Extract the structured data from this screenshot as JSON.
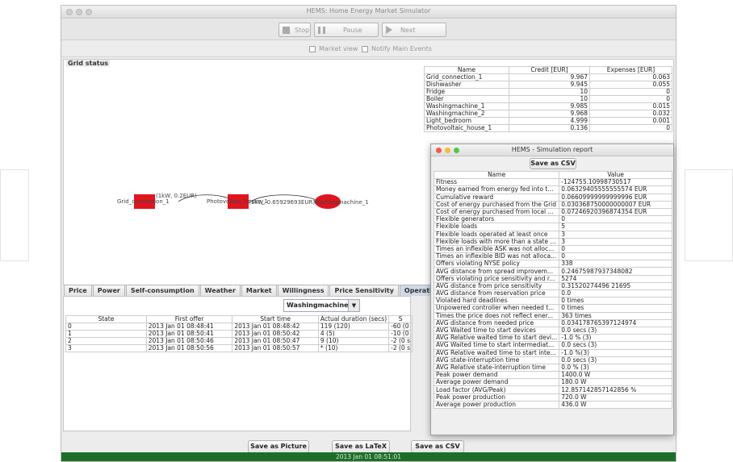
{
  "window": {
    "title": "HEMS: Home Energy Market Simulator"
  },
  "toolbar": {
    "stop_label": "Stop",
    "pause_label": "Pause",
    "next_label": "Next"
  },
  "options": {
    "market_view_label": "Market view",
    "notify_label": "Notify Main Events"
  },
  "grid_status": {
    "label": "Grid status",
    "credit_table": {
      "headers": [
        "Name",
        "Credit [EUR]",
        "Expenses [EUR]"
      ],
      "rows": [
        [
          "Grid_connection_1",
          "9.967",
          "0.063"
        ],
        [
          "Dishwasher",
          "9.945",
          "0.055"
        ],
        [
          "Fridge",
          "10",
          "0"
        ],
        [
          "Boiler",
          "10",
          "0"
        ],
        [
          "Washingmachine_1",
          "9.985",
          "0.015"
        ],
        [
          "Washingmachine_2",
          "9.968",
          "0.032"
        ],
        [
          "Light_bedroom",
          "4.999",
          "0.001"
        ],
        [
          "Photovoltaic_house_1",
          "0.136",
          "0"
        ]
      ]
    },
    "graph": {
      "node1": "Grid_connection_1",
      "edge1": "(1kW, 0.2EUR)",
      "node2": "Photovoltaic_house_1",
      "edge2": "(1kW, 0.65929693EUR)",
      "node3": "Washingmachine_1"
    }
  },
  "tabs": [
    "Price",
    "Power",
    "Self-consumption",
    "Weather",
    "Market",
    "Willingness",
    "Price Sensitivity",
    "Operations"
  ],
  "operations": {
    "device_selected": "Washingmachine_1",
    "headers": [
      "State",
      "First offer",
      "Start time",
      "Actual duration (secs)",
      "S"
    ],
    "rows": [
      [
        "0",
        "2013 Jan 01 08:48:41",
        "2013 Jan 01 08:48:42",
        "119 (120)",
        "-60 (0"
      ],
      [
        "1",
        "2013 Jan 01 08:50:41",
        "2013 Jan 01 08:50:42",
        "4 (5)",
        "-10 (0"
      ],
      [
        "2",
        "2013 Jan 01 08:50:46",
        "2013 Jan 01 08:50:47",
        "9 (10)",
        "-2 (0 s"
      ],
      [
        "3",
        "2013 Jan 01 08:50:56",
        "2013 Jan 01 08:50:57",
        "* (10)",
        "-2 (0 s"
      ]
    ]
  },
  "bottom_buttons": {
    "picture": "Save as Picture",
    "latex": "Save as LaTeX",
    "csv": "Save as CSV"
  },
  "status": {
    "time": "2013 Jan 01 08:51:01"
  },
  "report": {
    "title": "HEMS - Simulation report",
    "save_csv": "Save as CSV",
    "headers": [
      "Name",
      "Value"
    ],
    "rows": [
      [
        "Fitness",
        "-124755.10998730517"
      ],
      [
        "Money earned from energy fed into t...",
        "0.06329405555555574 EUR"
      ],
      [
        "Cumulative reward",
        "0.06609999999999996 EUR"
      ],
      [
        "Cost of energy purchased from the Grid",
        "0.030368750000000007 EUR"
      ],
      [
        "Cost of energy purchased from local ...",
        "0.07246920396874354 EUR"
      ],
      [
        "Flexible generators",
        "0"
      ],
      [
        "Flexible loads",
        "5"
      ],
      [
        "Flexible loads operated at least once",
        "3"
      ],
      [
        "Flexible loads with more than a state ...",
        "3"
      ],
      [
        "Times an inflexible ASK was not alloc...",
        "0"
      ],
      [
        "Times an inflexible BID was not alloca...",
        "0"
      ],
      [
        "Offers violating NYSE policy",
        "338"
      ],
      [
        "AVG distance from spread improvem...",
        "0.24675987937348082"
      ],
      [
        "Offers violating price sensitivity and r...",
        "5274"
      ],
      [
        "AVG distance from price sensitivity",
        "0.31520274496 21695"
      ],
      [
        "AVG distance from reservation price",
        "0.0"
      ],
      [
        "Violated hard deadlines",
        "0 times"
      ],
      [
        "Unpowered controller when needed t...",
        "0 times"
      ],
      [
        "Times the price does not reflect ener...",
        "363 times"
      ],
      [
        "AVG distance from needed price",
        "0.034178765397124974"
      ],
      [
        "AVG Waited time to start devices",
        "0.0 secs (3)"
      ],
      [
        "AVG Relative waited time to start devi...",
        "-1.0 % (3)"
      ],
      [
        "AVG Waited time to start intermediat...",
        "0.0 secs (3)"
      ],
      [
        "AVG Relative waited time to start inte...",
        "-1.0 %(3)"
      ],
      [
        "AVG state-interruption time",
        "0.0 secs (3)"
      ],
      [
        "AVG Relative state-interruption time",
        "0.0 % (3)"
      ],
      [
        "Peak power demand",
        "1400.0 W"
      ],
      [
        "Average power demand",
        "180.0 W"
      ],
      [
        "Load factor (AVG/Peak)",
        "12.857142857142856 %"
      ],
      [
        "Peak power production",
        "720.0 W"
      ],
      [
        "Average power production",
        "436.0 W"
      ]
    ]
  },
  "colors": {
    "node": "#e0151d",
    "status_bar": "#1e6e2b",
    "active_tab": "#cfd9e8"
  }
}
